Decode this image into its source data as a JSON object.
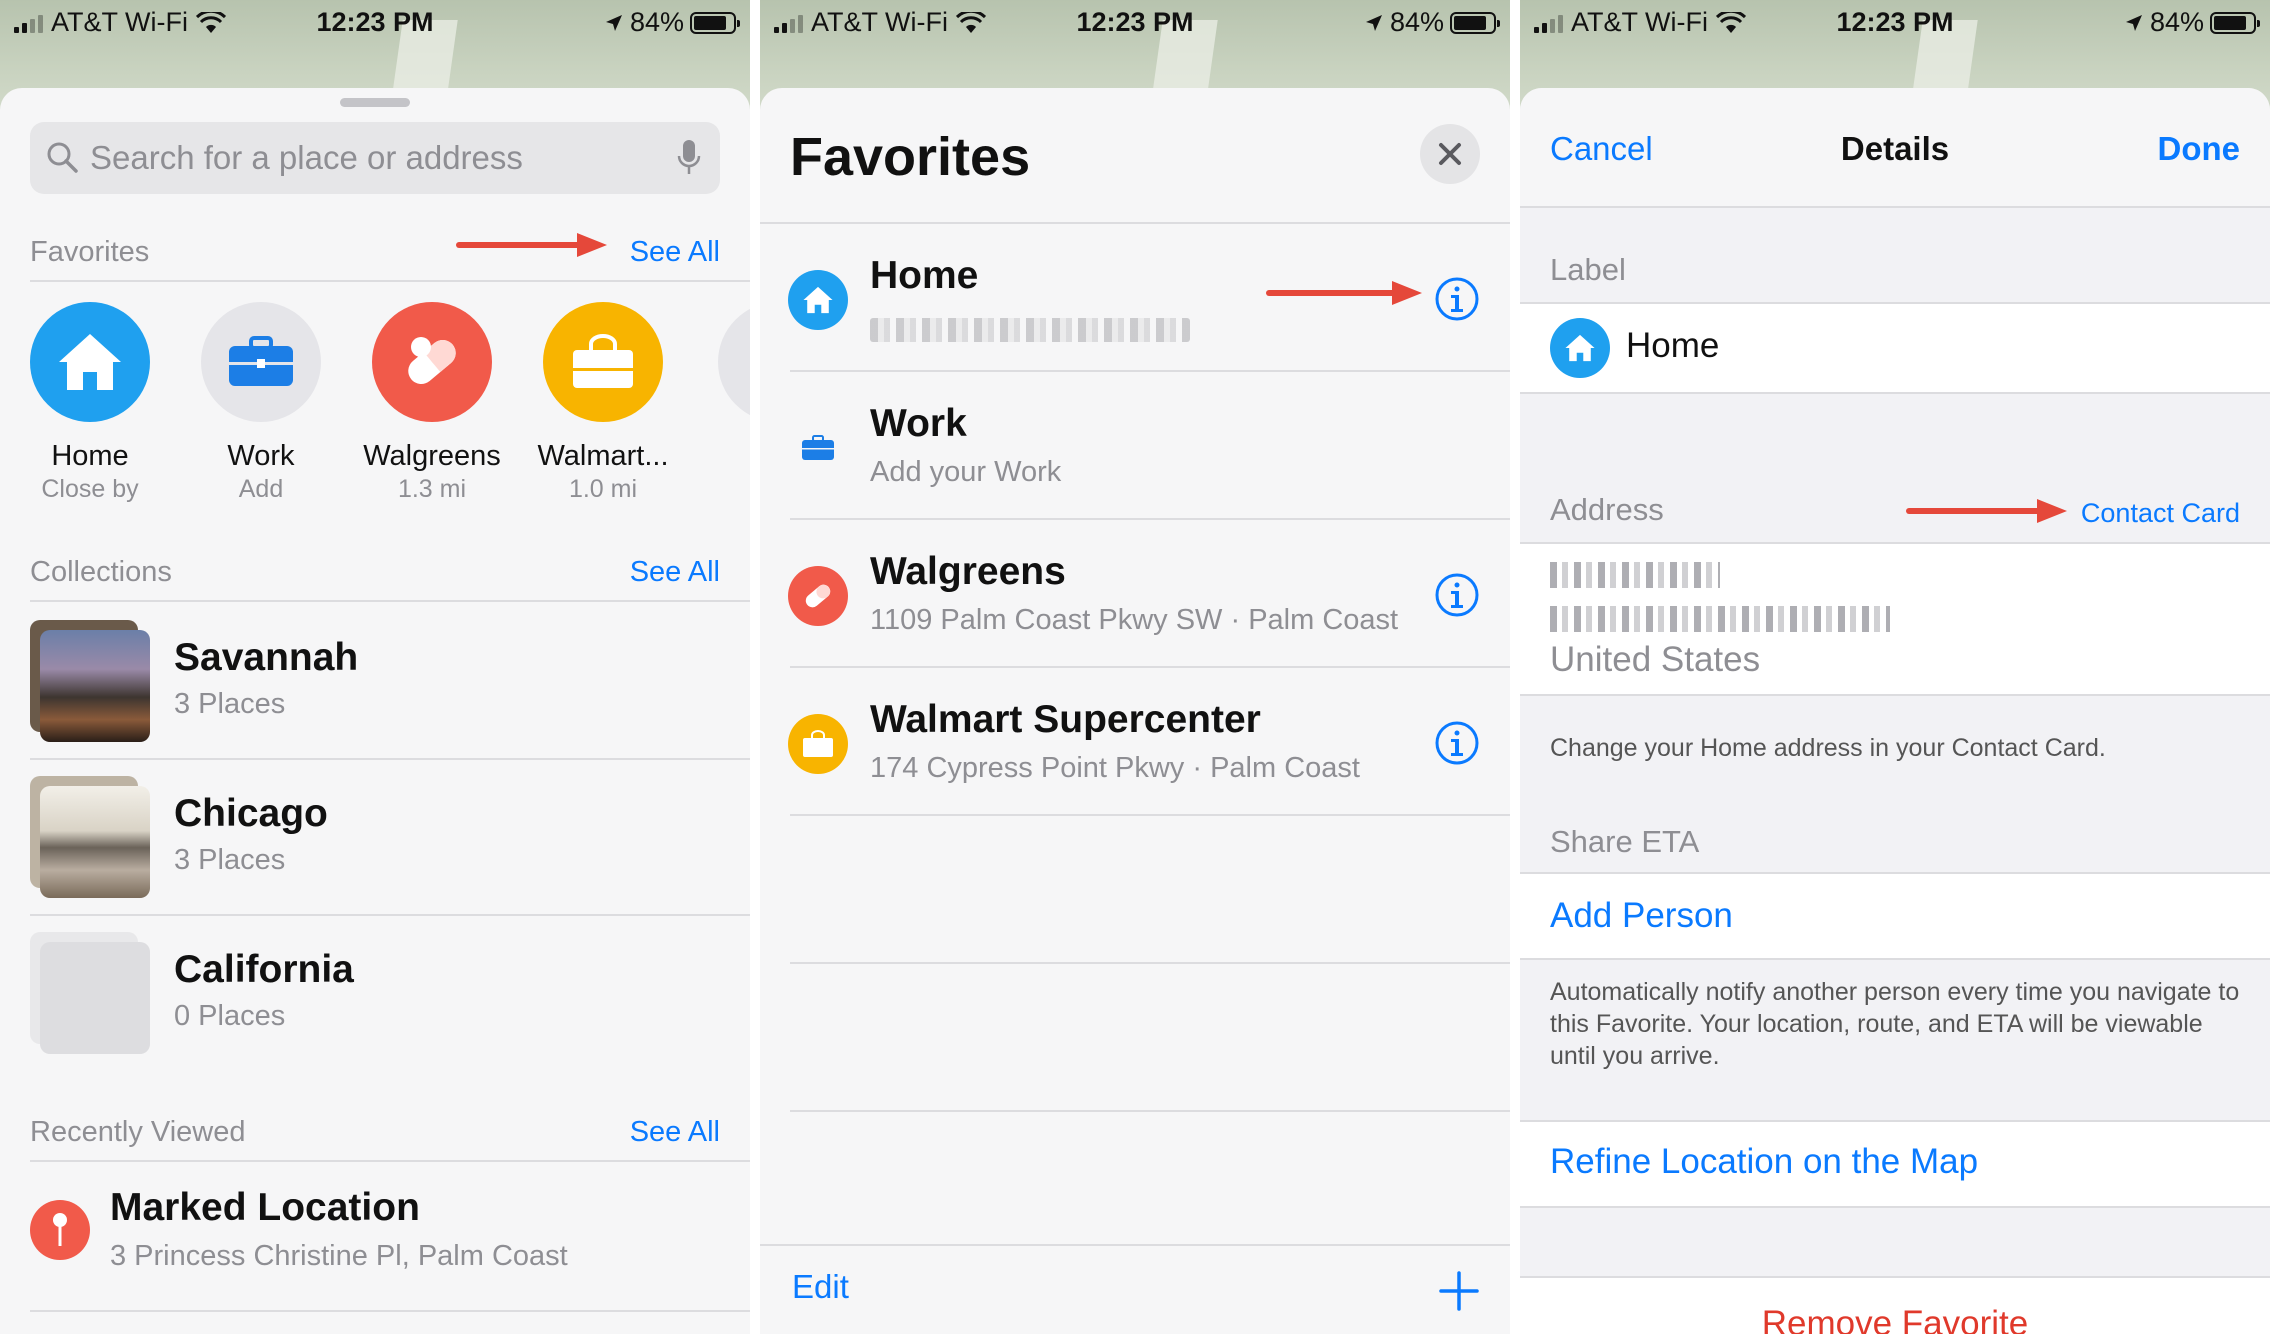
{
  "status_bar": {
    "carrier": "AT&T Wi-Fi",
    "time": "12:23 PM",
    "battery": "84%"
  },
  "screen1": {
    "search": {
      "placeholder": "Search for a place or address"
    },
    "favorites_header": {
      "title": "Favorites",
      "see_all": "See All"
    },
    "favorites": [
      {
        "name": "Home",
        "sub": "Close by",
        "color": "#1fa0ef",
        "icon": "house-icon"
      },
      {
        "name": "Work",
        "sub": "Add",
        "color": "#e5e5e9",
        "icon": "briefcase-icon"
      },
      {
        "name": "Walgreens",
        "sub": "1.3 mi",
        "color": "#f15a4a",
        "icon": "pill-icon"
      },
      {
        "name": "Walmart...",
        "sub": "1.0 mi",
        "color": "#f8b400",
        "icon": "shopping-bag-icon"
      }
    ],
    "collections_header": {
      "title": "Collections",
      "see_all": "See All"
    },
    "collections": [
      {
        "title": "Savannah",
        "count": "3 Places"
      },
      {
        "title": "Chicago",
        "count": "3 Places"
      },
      {
        "title": "California",
        "count": "0 Places"
      }
    ],
    "recent_header": {
      "title": "Recently Viewed",
      "see_all": "See All"
    },
    "recent": {
      "title": "Marked Location",
      "address": "3 Princess Christine Pl, Palm Coast"
    }
  },
  "screen2": {
    "title": "Favorites",
    "rows": [
      {
        "title": "Home",
        "sub": "",
        "color": "#1fa0ef",
        "icon": "house-icon"
      },
      {
        "title": "Work",
        "sub": "Add your Work",
        "color": "#ffffff",
        "icon": "briefcase-icon"
      },
      {
        "title": "Walgreens",
        "sub": "1109 Palm Coast Pkwy SW · Palm Coast",
        "color": "#f15a4a",
        "icon": "pill-icon"
      },
      {
        "title": "Walmart Supercenter",
        "sub": "174 Cypress Point Pkwy · Palm Coast",
        "color": "#f8b400",
        "icon": "shopping-bag-icon"
      }
    ],
    "footer": {
      "edit": "Edit"
    }
  },
  "screen3": {
    "nav": {
      "cancel": "Cancel",
      "title": "Details",
      "done": "Done"
    },
    "label_header": "Label",
    "label_value": "Home",
    "address_header": "Address",
    "contact_card": "Contact Card",
    "country": "United States",
    "address_note": "Change your Home address in your Contact Card.",
    "share_header": "Share ETA",
    "add_person": "Add Person",
    "share_note": "Automatically notify another person every time you navigate to this Favorite. Your location, route, and ETA will be viewable until you arrive.",
    "refine": "Refine Location on the Map",
    "remove": "Remove Favorite"
  },
  "colors": {
    "accent": "#0a7aff",
    "annotation_arrow": "#e5483a"
  }
}
